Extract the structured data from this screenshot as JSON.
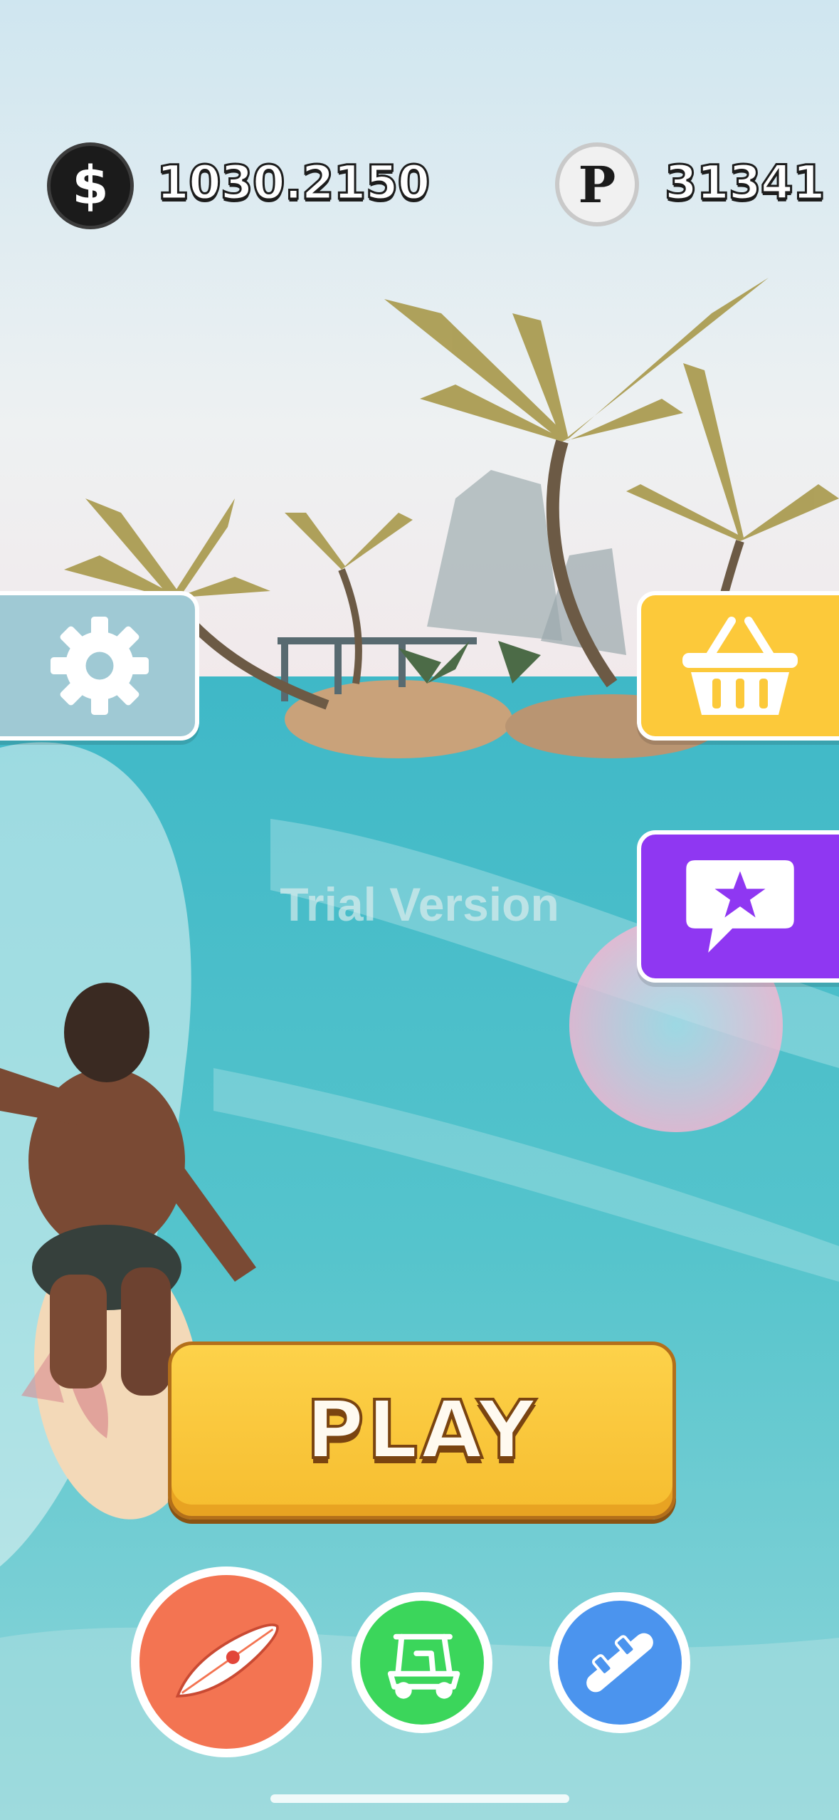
{
  "hud": {
    "cash_value": "1030.2150",
    "points_value": "31341",
    "cash_icon_symbol": "$",
    "points_icon_symbol": "P"
  },
  "watermark": "Trial Version",
  "play_button": {
    "label": "PLAY"
  },
  "side_buttons": [
    {
      "icon": "gear-icon",
      "color": "#9fc9d4"
    },
    {
      "icon": "basket-icon",
      "color": "#fcc93a"
    },
    {
      "icon": "star-chat-icon",
      "color": "#8f37f2"
    }
  ],
  "mode_buttons": [
    {
      "icon": "surfboard-icon",
      "color": "#f37452",
      "selected": true
    },
    {
      "icon": "golf-cart-icon",
      "color": "#3bd65b",
      "selected": false
    },
    {
      "icon": "snowboard-icon",
      "color": "#4b94ee",
      "selected": false
    }
  ]
}
